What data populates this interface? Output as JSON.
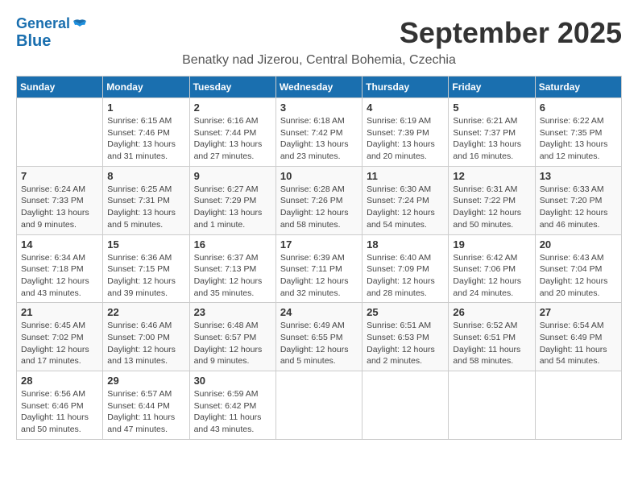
{
  "header": {
    "logo_general": "General",
    "logo_blue": "Blue",
    "title": "September 2025",
    "subtitle": "Benatky nad Jizerou, Central Bohemia, Czechia"
  },
  "days_of_week": [
    "Sunday",
    "Monday",
    "Tuesday",
    "Wednesday",
    "Thursday",
    "Friday",
    "Saturday"
  ],
  "weeks": [
    [
      {
        "day": "",
        "info": ""
      },
      {
        "day": "1",
        "info": "Sunrise: 6:15 AM\nSunset: 7:46 PM\nDaylight: 13 hours and 31 minutes."
      },
      {
        "day": "2",
        "info": "Sunrise: 6:16 AM\nSunset: 7:44 PM\nDaylight: 13 hours and 27 minutes."
      },
      {
        "day": "3",
        "info": "Sunrise: 6:18 AM\nSunset: 7:42 PM\nDaylight: 13 hours and 23 minutes."
      },
      {
        "day": "4",
        "info": "Sunrise: 6:19 AM\nSunset: 7:39 PM\nDaylight: 13 hours and 20 minutes."
      },
      {
        "day": "5",
        "info": "Sunrise: 6:21 AM\nSunset: 7:37 PM\nDaylight: 13 hours and 16 minutes."
      },
      {
        "day": "6",
        "info": "Sunrise: 6:22 AM\nSunset: 7:35 PM\nDaylight: 13 hours and 12 minutes."
      }
    ],
    [
      {
        "day": "7",
        "info": "Sunrise: 6:24 AM\nSunset: 7:33 PM\nDaylight: 13 hours and 9 minutes."
      },
      {
        "day": "8",
        "info": "Sunrise: 6:25 AM\nSunset: 7:31 PM\nDaylight: 13 hours and 5 minutes."
      },
      {
        "day": "9",
        "info": "Sunrise: 6:27 AM\nSunset: 7:29 PM\nDaylight: 13 hours and 1 minute."
      },
      {
        "day": "10",
        "info": "Sunrise: 6:28 AM\nSunset: 7:26 PM\nDaylight: 12 hours and 58 minutes."
      },
      {
        "day": "11",
        "info": "Sunrise: 6:30 AM\nSunset: 7:24 PM\nDaylight: 12 hours and 54 minutes."
      },
      {
        "day": "12",
        "info": "Sunrise: 6:31 AM\nSunset: 7:22 PM\nDaylight: 12 hours and 50 minutes."
      },
      {
        "day": "13",
        "info": "Sunrise: 6:33 AM\nSunset: 7:20 PM\nDaylight: 12 hours and 46 minutes."
      }
    ],
    [
      {
        "day": "14",
        "info": "Sunrise: 6:34 AM\nSunset: 7:18 PM\nDaylight: 12 hours and 43 minutes."
      },
      {
        "day": "15",
        "info": "Sunrise: 6:36 AM\nSunset: 7:15 PM\nDaylight: 12 hours and 39 minutes."
      },
      {
        "day": "16",
        "info": "Sunrise: 6:37 AM\nSunset: 7:13 PM\nDaylight: 12 hours and 35 minutes."
      },
      {
        "day": "17",
        "info": "Sunrise: 6:39 AM\nSunset: 7:11 PM\nDaylight: 12 hours and 32 minutes."
      },
      {
        "day": "18",
        "info": "Sunrise: 6:40 AM\nSunset: 7:09 PM\nDaylight: 12 hours and 28 minutes."
      },
      {
        "day": "19",
        "info": "Sunrise: 6:42 AM\nSunset: 7:06 PM\nDaylight: 12 hours and 24 minutes."
      },
      {
        "day": "20",
        "info": "Sunrise: 6:43 AM\nSunset: 7:04 PM\nDaylight: 12 hours and 20 minutes."
      }
    ],
    [
      {
        "day": "21",
        "info": "Sunrise: 6:45 AM\nSunset: 7:02 PM\nDaylight: 12 hours and 17 minutes."
      },
      {
        "day": "22",
        "info": "Sunrise: 6:46 AM\nSunset: 7:00 PM\nDaylight: 12 hours and 13 minutes."
      },
      {
        "day": "23",
        "info": "Sunrise: 6:48 AM\nSunset: 6:57 PM\nDaylight: 12 hours and 9 minutes."
      },
      {
        "day": "24",
        "info": "Sunrise: 6:49 AM\nSunset: 6:55 PM\nDaylight: 12 hours and 5 minutes."
      },
      {
        "day": "25",
        "info": "Sunrise: 6:51 AM\nSunset: 6:53 PM\nDaylight: 12 hours and 2 minutes."
      },
      {
        "day": "26",
        "info": "Sunrise: 6:52 AM\nSunset: 6:51 PM\nDaylight: 11 hours and 58 minutes."
      },
      {
        "day": "27",
        "info": "Sunrise: 6:54 AM\nSunset: 6:49 PM\nDaylight: 11 hours and 54 minutes."
      }
    ],
    [
      {
        "day": "28",
        "info": "Sunrise: 6:56 AM\nSunset: 6:46 PM\nDaylight: 11 hours and 50 minutes."
      },
      {
        "day": "29",
        "info": "Sunrise: 6:57 AM\nSunset: 6:44 PM\nDaylight: 11 hours and 47 minutes."
      },
      {
        "day": "30",
        "info": "Sunrise: 6:59 AM\nSunset: 6:42 PM\nDaylight: 11 hours and 43 minutes."
      },
      {
        "day": "",
        "info": ""
      },
      {
        "day": "",
        "info": ""
      },
      {
        "day": "",
        "info": ""
      },
      {
        "day": "",
        "info": ""
      }
    ]
  ]
}
